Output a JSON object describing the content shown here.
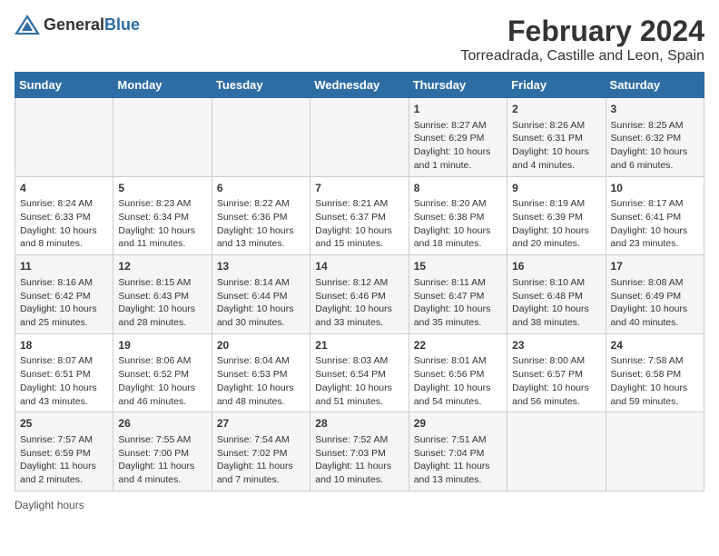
{
  "header": {
    "logo_general": "General",
    "logo_blue": "Blue",
    "title": "February 2024",
    "subtitle": "Torreadrada, Castille and Leon, Spain"
  },
  "days_of_week": [
    "Sunday",
    "Monday",
    "Tuesday",
    "Wednesday",
    "Thursday",
    "Friday",
    "Saturday"
  ],
  "footer": {
    "daylight_label": "Daylight hours"
  },
  "weeks": [
    [
      {
        "day": "",
        "info": ""
      },
      {
        "day": "",
        "info": ""
      },
      {
        "day": "",
        "info": ""
      },
      {
        "day": "",
        "info": ""
      },
      {
        "day": "1",
        "info": "Sunrise: 8:27 AM\nSunset: 6:29 PM\nDaylight: 10 hours and 1 minute."
      },
      {
        "day": "2",
        "info": "Sunrise: 8:26 AM\nSunset: 6:31 PM\nDaylight: 10 hours and 4 minutes."
      },
      {
        "day": "3",
        "info": "Sunrise: 8:25 AM\nSunset: 6:32 PM\nDaylight: 10 hours and 6 minutes."
      }
    ],
    [
      {
        "day": "4",
        "info": "Sunrise: 8:24 AM\nSunset: 6:33 PM\nDaylight: 10 hours and 8 minutes."
      },
      {
        "day": "5",
        "info": "Sunrise: 8:23 AM\nSunset: 6:34 PM\nDaylight: 10 hours and 11 minutes."
      },
      {
        "day": "6",
        "info": "Sunrise: 8:22 AM\nSunset: 6:36 PM\nDaylight: 10 hours and 13 minutes."
      },
      {
        "day": "7",
        "info": "Sunrise: 8:21 AM\nSunset: 6:37 PM\nDaylight: 10 hours and 15 minutes."
      },
      {
        "day": "8",
        "info": "Sunrise: 8:20 AM\nSunset: 6:38 PM\nDaylight: 10 hours and 18 minutes."
      },
      {
        "day": "9",
        "info": "Sunrise: 8:19 AM\nSunset: 6:39 PM\nDaylight: 10 hours and 20 minutes."
      },
      {
        "day": "10",
        "info": "Sunrise: 8:17 AM\nSunset: 6:41 PM\nDaylight: 10 hours and 23 minutes."
      }
    ],
    [
      {
        "day": "11",
        "info": "Sunrise: 8:16 AM\nSunset: 6:42 PM\nDaylight: 10 hours and 25 minutes."
      },
      {
        "day": "12",
        "info": "Sunrise: 8:15 AM\nSunset: 6:43 PM\nDaylight: 10 hours and 28 minutes."
      },
      {
        "day": "13",
        "info": "Sunrise: 8:14 AM\nSunset: 6:44 PM\nDaylight: 10 hours and 30 minutes."
      },
      {
        "day": "14",
        "info": "Sunrise: 8:12 AM\nSunset: 6:46 PM\nDaylight: 10 hours and 33 minutes."
      },
      {
        "day": "15",
        "info": "Sunrise: 8:11 AM\nSunset: 6:47 PM\nDaylight: 10 hours and 35 minutes."
      },
      {
        "day": "16",
        "info": "Sunrise: 8:10 AM\nSunset: 6:48 PM\nDaylight: 10 hours and 38 minutes."
      },
      {
        "day": "17",
        "info": "Sunrise: 8:08 AM\nSunset: 6:49 PM\nDaylight: 10 hours and 40 minutes."
      }
    ],
    [
      {
        "day": "18",
        "info": "Sunrise: 8:07 AM\nSunset: 6:51 PM\nDaylight: 10 hours and 43 minutes."
      },
      {
        "day": "19",
        "info": "Sunrise: 8:06 AM\nSunset: 6:52 PM\nDaylight: 10 hours and 46 minutes."
      },
      {
        "day": "20",
        "info": "Sunrise: 8:04 AM\nSunset: 6:53 PM\nDaylight: 10 hours and 48 minutes."
      },
      {
        "day": "21",
        "info": "Sunrise: 8:03 AM\nSunset: 6:54 PM\nDaylight: 10 hours and 51 minutes."
      },
      {
        "day": "22",
        "info": "Sunrise: 8:01 AM\nSunset: 6:56 PM\nDaylight: 10 hours and 54 minutes."
      },
      {
        "day": "23",
        "info": "Sunrise: 8:00 AM\nSunset: 6:57 PM\nDaylight: 10 hours and 56 minutes."
      },
      {
        "day": "24",
        "info": "Sunrise: 7:58 AM\nSunset: 6:58 PM\nDaylight: 10 hours and 59 minutes."
      }
    ],
    [
      {
        "day": "25",
        "info": "Sunrise: 7:57 AM\nSunset: 6:59 PM\nDaylight: 11 hours and 2 minutes."
      },
      {
        "day": "26",
        "info": "Sunrise: 7:55 AM\nSunset: 7:00 PM\nDaylight: 11 hours and 4 minutes."
      },
      {
        "day": "27",
        "info": "Sunrise: 7:54 AM\nSunset: 7:02 PM\nDaylight: 11 hours and 7 minutes."
      },
      {
        "day": "28",
        "info": "Sunrise: 7:52 AM\nSunset: 7:03 PM\nDaylight: 11 hours and 10 minutes."
      },
      {
        "day": "29",
        "info": "Sunrise: 7:51 AM\nSunset: 7:04 PM\nDaylight: 11 hours and 13 minutes."
      },
      {
        "day": "",
        "info": ""
      },
      {
        "day": "",
        "info": ""
      }
    ]
  ]
}
